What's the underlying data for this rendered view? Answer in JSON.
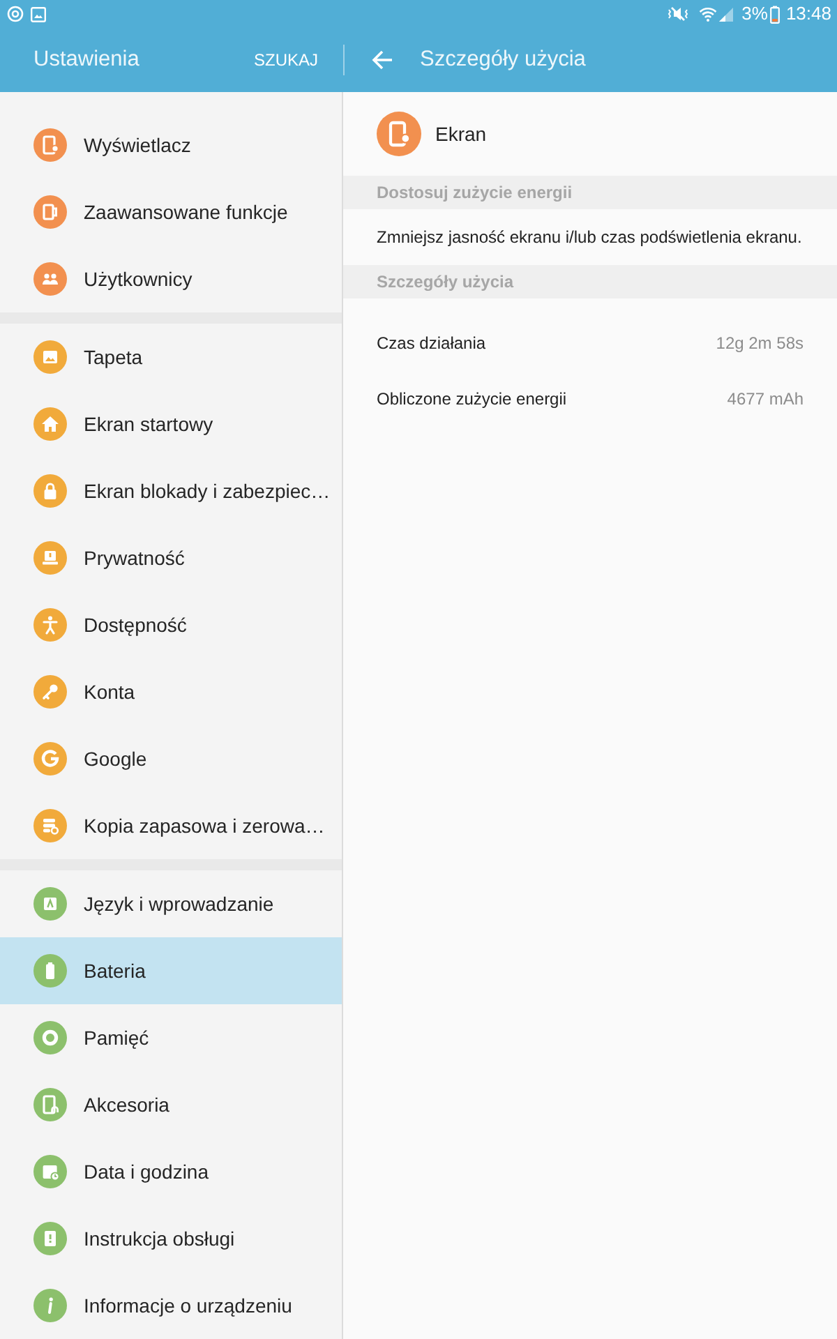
{
  "status_bar": {
    "battery": "3%",
    "time": "13:48"
  },
  "sidebar": {
    "title": "Ustawienia",
    "search_button": "SZUKAJ",
    "groups": [
      {
        "items": [
          {
            "label": "Wyświetlacz",
            "color": "#f2904f",
            "selected": false
          },
          {
            "label": "Zaawansowane funkcje",
            "color": "#f2904f",
            "selected": false
          },
          {
            "label": "Użytkownicy",
            "color": "#f2904f",
            "selected": false
          }
        ]
      },
      {
        "items": [
          {
            "label": "Tapeta",
            "color": "#f1aa3b",
            "selected": false
          },
          {
            "label": "Ekran startowy",
            "color": "#f1aa3b",
            "selected": false
          },
          {
            "label": "Ekran blokady i zabezpiec…",
            "color": "#f1aa3b",
            "selected": false
          },
          {
            "label": "Prywatność",
            "color": "#f1aa3b",
            "selected": false
          },
          {
            "label": "Dostępność",
            "color": "#f1aa3b",
            "selected": false
          },
          {
            "label": "Konta",
            "color": "#f1aa3b",
            "selected": false
          },
          {
            "label": "Google",
            "color": "#f1aa3b",
            "selected": false
          },
          {
            "label": "Kopia zapasowa i zerowa…",
            "color": "#f1aa3b",
            "selected": false
          }
        ]
      },
      {
        "items": [
          {
            "label": "Język i wprowadzanie",
            "color": "#8cc06c",
            "selected": false
          },
          {
            "label": "Bateria",
            "color": "#8cc06c",
            "selected": true
          },
          {
            "label": "Pamięć",
            "color": "#8cc06c",
            "selected": false
          },
          {
            "label": "Akcesoria",
            "color": "#8cc06c",
            "selected": false
          },
          {
            "label": "Data i godzina",
            "color": "#8cc06c",
            "selected": false
          },
          {
            "label": "Instrukcja obsługi",
            "color": "#8cc06c",
            "selected": false
          },
          {
            "label": "Informacje o urządzeniu",
            "color": "#8cc06c",
            "selected": false
          }
        ]
      }
    ]
  },
  "detail": {
    "title": "Szczegóły użycia",
    "app": {
      "name": "Ekran",
      "color": "#f2904f"
    },
    "sections": [
      {
        "kind": "text",
        "header": "Dostosuj zużycie energii",
        "text": "Zmniejsz jasność ekranu i/lub czas podświetlenia ekranu."
      },
      {
        "kind": "rows",
        "header": "Szczegóły użycia",
        "rows": [
          {
            "label": "Czas działania",
            "value": "12g 2m 58s"
          },
          {
            "label": "Obliczone zużycie energii",
            "value": "4677 mAh"
          }
        ]
      }
    ]
  }
}
